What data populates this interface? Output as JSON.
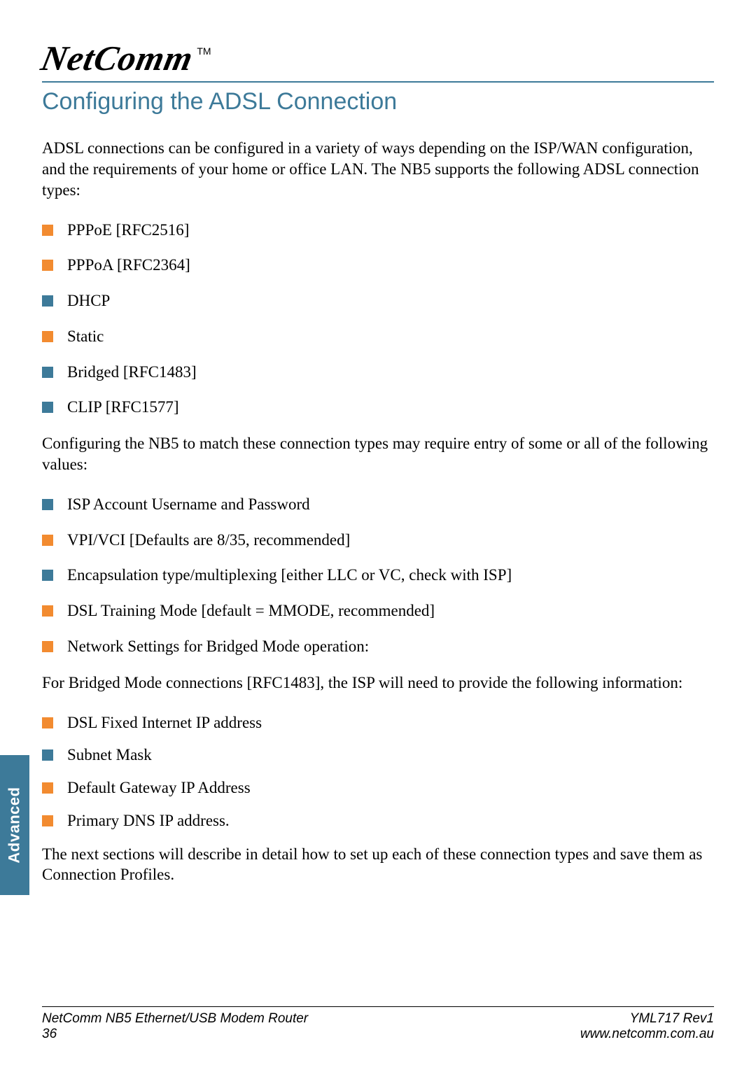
{
  "brand": {
    "name": "NetComm",
    "tm": "TM"
  },
  "heading": "Configuring the ADSL Connection",
  "intro": "ADSL connections can be configured in a variety of ways depending on the ISP/WAN configuration, and the requirements of your home or office LAN.  The NB5 supports the following ADSL connection types:",
  "conn_types": [
    {
      "label": "PPPoE [RFC2516]",
      "color": "orange"
    },
    {
      "label": "PPPoA [RFC2364]",
      "color": "orange"
    },
    {
      "label": "DHCP",
      "color": "blue"
    },
    {
      "label": "Static",
      "color": "orange"
    },
    {
      "label": "Bridged [RFC1483]",
      "color": "blue"
    },
    {
      "label": "CLIP [RFC1577]",
      "color": "blue"
    }
  ],
  "values_intro": "Configuring the NB5 to match these connection types may require entry of some or all of the following values:",
  "values": [
    {
      "label": "ISP Account Username and Password",
      "color": "blue"
    },
    {
      "label": "VPI/VCI [Defaults are 8/35, recommended]",
      "color": "orange"
    },
    {
      "label": "Encapsulation type/multiplexing [either LLC or VC, check with ISP]",
      "color": "blue"
    },
    {
      "label": "DSL Training Mode [default = MMODE, recommended]",
      "color": "orange"
    },
    {
      "label": "Network Settings for Bridged Mode operation:",
      "color": "orange"
    }
  ],
  "bridge_intro": "For Bridged Mode connections [RFC1483], the ISP will need to provide the following information:",
  "bridge_values": [
    {
      "label": "DSL Fixed Internet IP address",
      "color": "orange"
    },
    {
      "label": "Subnet Mask",
      "color": "blue"
    },
    {
      "label": "Default Gateway IP Address",
      "color": "orange"
    },
    {
      "label": "Primary DNS IP address.",
      "color": "orange"
    }
  ],
  "outro": "The next sections will describe in detail how to set up each of these connection types and save them as Connection Profiles.",
  "side_tab": "Advanced",
  "footer": {
    "product": "NetComm NB5 Ethernet/USB Modem Router",
    "page_number": "36",
    "rev": "YML717 Rev1",
    "url": "www.netcomm.com.au"
  }
}
